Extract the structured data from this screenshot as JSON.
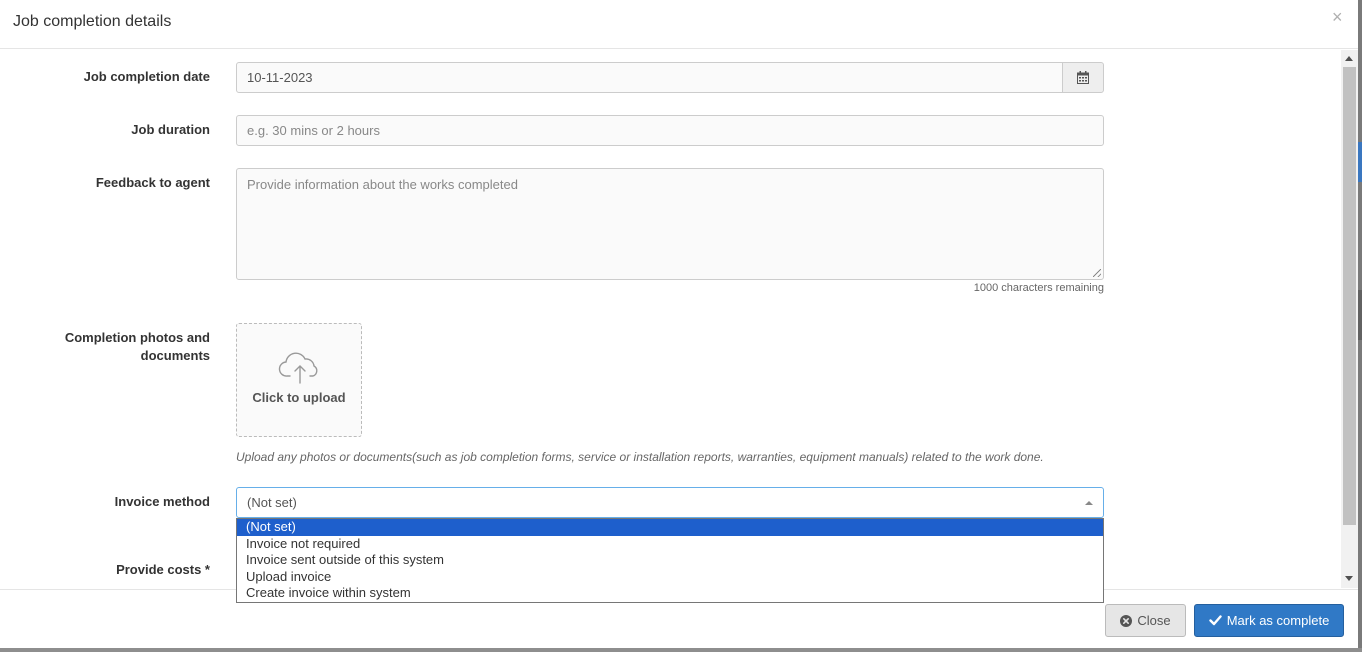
{
  "modal": {
    "title": "Job completion details",
    "close_glyph": "×"
  },
  "form": {
    "completion_date": {
      "label": "Job completion date",
      "value": "10-11-2023",
      "icon": "calendar-icon"
    },
    "duration": {
      "label": "Job duration",
      "placeholder": "e.g. 30 mins or 2 hours"
    },
    "feedback": {
      "label": "Feedback to agent",
      "placeholder": "Provide information about the works completed",
      "chars_remaining": "1000 characters remaining"
    },
    "photos": {
      "label_line1": "Completion photos and",
      "label_line2": "documents",
      "upload_label": "Click to upload",
      "upload_icon": "cloud-upload-icon",
      "help_text": "Upload any photos or documents(such as job completion forms, service or installation reports, warranties, equipment manuals) related to the work done."
    },
    "invoice_method": {
      "label": "Invoice method",
      "selected": "(Not set)",
      "options": [
        "(Not set)",
        "Invoice not required",
        "Invoice sent outside of this system",
        "Upload invoice",
        "Create invoice within system"
      ]
    },
    "costs": {
      "label": "Provide costs *"
    }
  },
  "footer": {
    "close_label": "Close",
    "close_icon": "times-circle-icon",
    "complete_label": "Mark as complete",
    "complete_icon": "check-icon"
  },
  "colors": {
    "primary": "#3079c6",
    "option_highlight": "#1e5fcc",
    "focus_border": "#66afe9"
  }
}
